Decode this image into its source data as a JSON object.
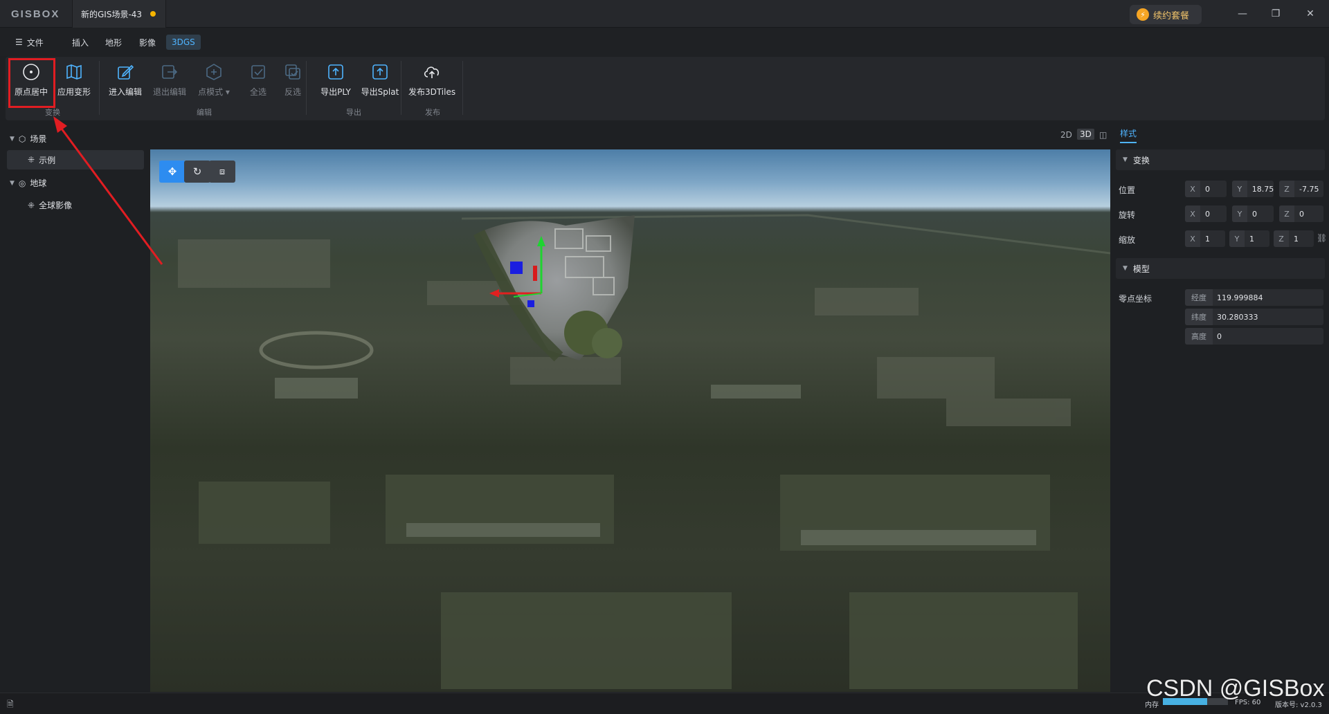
{
  "app": {
    "logo": "GISBOX",
    "tab_title": "新的GIS场景-43",
    "renew_label": "续约套餐"
  },
  "menu": {
    "file": "文件",
    "insert": "插入",
    "terrain": "地形",
    "imagery": "影像",
    "gs": "3DGS"
  },
  "ribbon": {
    "origin_center": "原点居中",
    "apply_transform": "应用变形",
    "enter_edit": "进入编辑",
    "exit_edit": "退出编辑",
    "point_mode": "点模式",
    "select_all": "全选",
    "invert_select": "反选",
    "export_ply": "导出PLY",
    "export_splat": "导出Splat",
    "publish_3dtiles": "发布3DTiles",
    "groups": {
      "transform": "变换",
      "edit": "编辑",
      "export": "导出",
      "publish": "发布"
    }
  },
  "tree": {
    "scene": "场景",
    "example": "示例",
    "earth": "地球",
    "global_imagery": "全球影像"
  },
  "view_modes": {
    "m2d": "2D",
    "m3d": "3D"
  },
  "props": {
    "tab": "样式",
    "transform_section": "变换",
    "position_label": "位置",
    "rotation_label": "旋转",
    "scale_label": "缩放",
    "position": {
      "x": "0",
      "y": "18.75",
      "z": "-7.75"
    },
    "rotation": {
      "x": "0",
      "y": "0",
      "z": "0"
    },
    "scale": {
      "x": "1",
      "y": "1",
      "z": "1"
    },
    "axis": {
      "x": "X",
      "y": "Y",
      "z": "Z"
    },
    "model_section": "模型",
    "zero_label": "零点坐标",
    "lon_label": "经度",
    "lon": "119.999884",
    "lat_label": "纬度",
    "lat": "30.280333",
    "alt_label": "高度",
    "alt": "0"
  },
  "status": {
    "memory_label": "内存",
    "memory_fraction": 0.68,
    "fps": "FPS: 60",
    "version": "版本号: v2.0.3"
  },
  "watermark": "CSDN @GISBox",
  "colors": {
    "accent": "#4fb4ff",
    "highlight": "#e11d22",
    "tool_active": "#2d8cf0"
  }
}
